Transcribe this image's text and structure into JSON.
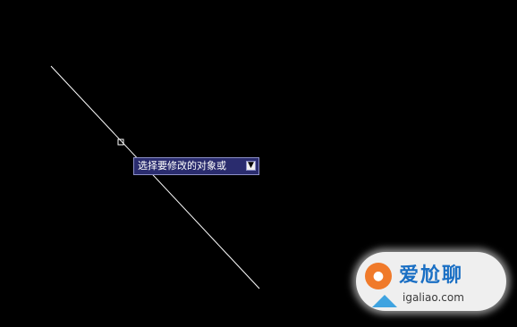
{
  "tooltip": {
    "prompt_text": "选择要修改的对象或",
    "arrow_icon": "down-arrow-icon"
  },
  "watermark": {
    "title": "爱尬聊",
    "url": "igaliao.com"
  },
  "colors": {
    "background": "#000000",
    "line": "#ffffff",
    "tooltip_bg": "#2a2c6e",
    "tooltip_border": "#8c8fc8"
  }
}
